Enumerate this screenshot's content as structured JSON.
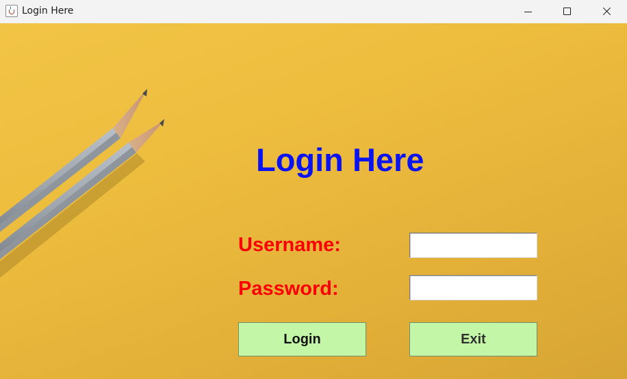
{
  "window": {
    "title": "Login Here",
    "icon": "java-cup-icon",
    "controls": [
      "minimize-icon",
      "maximize-icon",
      "close-icon"
    ]
  },
  "form": {
    "heading": "Login Here",
    "username_label": "Username:",
    "username_value": "",
    "password_label": "Password:",
    "password_value": "",
    "login_label": "Login",
    "exit_label": "Exit"
  },
  "colors": {
    "heading": "#0a14f0",
    "labels": "#fb0000",
    "button_bg": "#c3f7a7",
    "background": "#edbd3e"
  }
}
